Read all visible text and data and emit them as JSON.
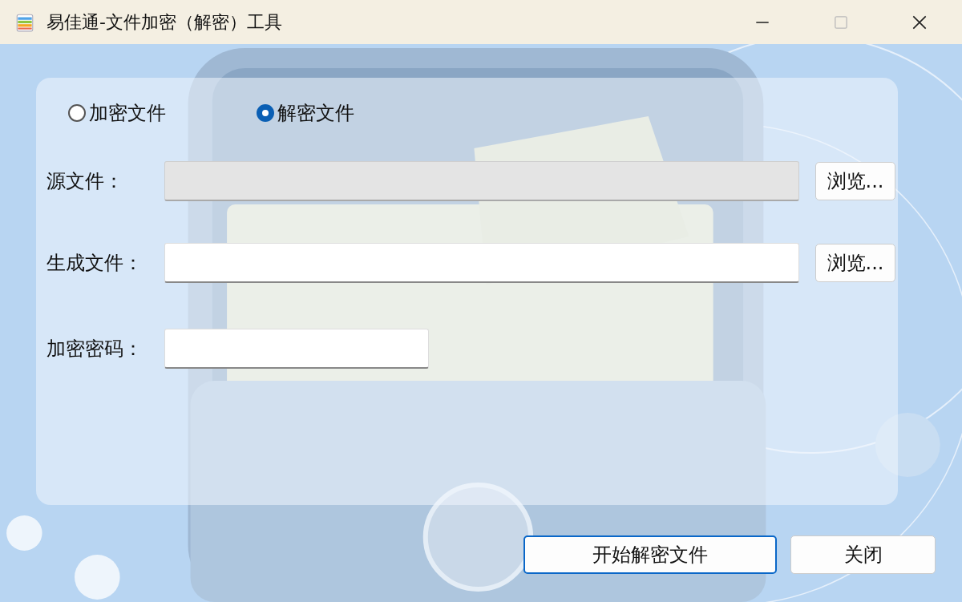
{
  "window": {
    "title": "易佳通-文件加密（解密）工具"
  },
  "modes": [
    {
      "label": "加密文件",
      "selected": false
    },
    {
      "label": "解密文件",
      "selected": true
    }
  ],
  "fields": [
    {
      "kind": "path",
      "label": "源文件：",
      "disabled": true,
      "browse": "浏览..."
    },
    {
      "kind": "path",
      "label": "生成文件：",
      "disabled": false,
      "browse": "浏览..."
    },
    {
      "kind": "password",
      "label": "加密密码：",
      "disabled": false
    }
  ],
  "buttons": [
    {
      "label": "开始解密文件",
      "default": true
    },
    {
      "label": "关闭",
      "default": false
    }
  ]
}
